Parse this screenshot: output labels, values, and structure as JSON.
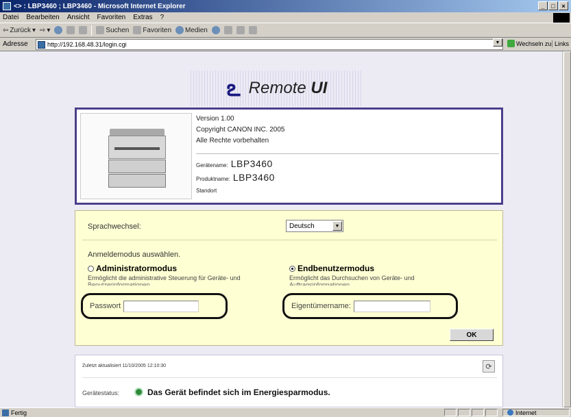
{
  "window": {
    "title": "<> : LBP3460 ; LBP3460 - Microsoft Internet Explorer",
    "controls": [
      "_",
      "□",
      "×"
    ]
  },
  "menu": [
    "Datei",
    "Bearbeiten",
    "Ansicht",
    "Favoriten",
    "Extras",
    "?"
  ],
  "toolbar": {
    "back": "Zurück",
    "search": "Suchen",
    "favorites": "Favoriten",
    "media": "Medien"
  },
  "address": {
    "label": "Adresse",
    "url": "http://192.168.48.31/login.cgi",
    "go_label": "Wechseln zu",
    "links_label": "Links"
  },
  "logo": {
    "text_light": "Remote",
    "text_bold": "UI"
  },
  "device": {
    "version": "Version 1.00",
    "copyright": "Copyright CANON INC. 2005",
    "rights": "Alle Rechte vorbehalten",
    "device_name_label": "Gerätename:",
    "device_name": "LBP3460",
    "product_name_label": "Produktname:",
    "product_name": "LBP3460",
    "location_label": "Standort"
  },
  "login": {
    "language_label": "Sprachwechsel:",
    "language_value": "Deutsch",
    "mode_title": "Anmeldemodus auswählen.",
    "admin": {
      "label": "Administratormodus",
      "desc": "Ermöglicht die administrative Steuerung für Geräte- und",
      "desc_cut": "Benutzerinformationen.",
      "selected": false,
      "field_label": "Passwort"
    },
    "user": {
      "label": "Endbenutzermodus",
      "desc": "Ermöglicht das Durchsuchen von Geräte- und",
      "desc_cut": "Auftragsinformationen.",
      "selected": true,
      "field_label": "Eigentümername:"
    },
    "ok_label": "OK"
  },
  "status": {
    "updated": "Zuletzt aktualisiert 11/10/2005 12:10:30",
    "state_label": "Gerätestatus:",
    "state_text": "Das Gerät befindet sich im Energiesparmodus.",
    "state_color": "#2e8b3a"
  },
  "statusbar": {
    "ready": "Fertig",
    "zone": "Internet"
  }
}
